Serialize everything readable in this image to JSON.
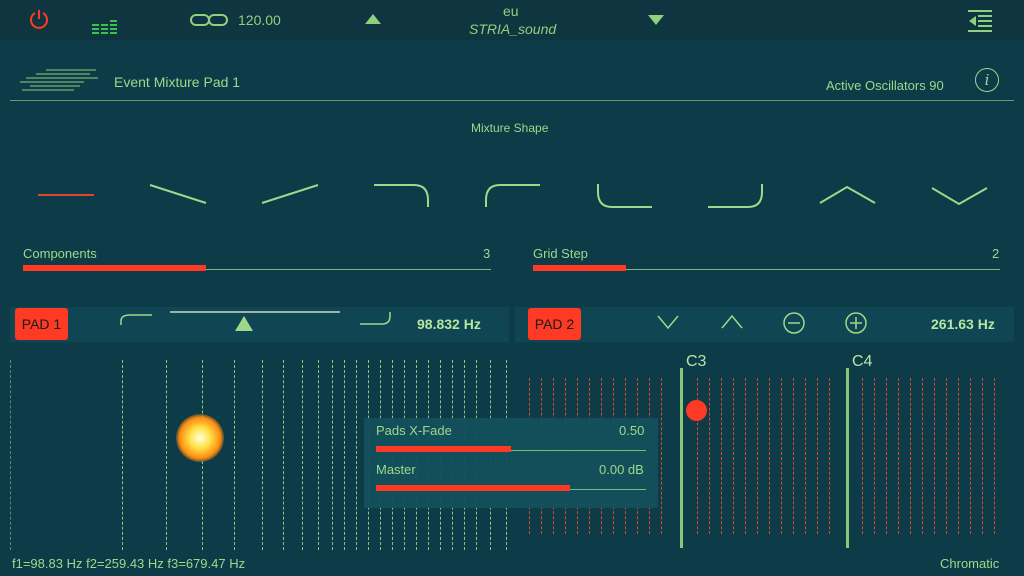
{
  "topbar": {
    "tempo": "120.00",
    "preset_bank": "eu",
    "preset_name": "STRIA_sound"
  },
  "header": {
    "title": "Event Mixture Pad 1",
    "active_oscillators": "Active Oscillators 90",
    "info_glyph": "i"
  },
  "mixture": {
    "label": "Mixture Shape",
    "shapes": [
      "flat",
      "falling",
      "rising",
      "top-right-curve",
      "top-left-curve",
      "bottom-left-curve",
      "bottom-right-curve",
      "peak",
      "valley"
    ]
  },
  "sliders": {
    "components": {
      "label": "Components",
      "value": "3",
      "fraction": 0.39
    },
    "grid_step": {
      "label": "Grid Step",
      "value": "2",
      "fraction": 0.2
    }
  },
  "pad1": {
    "button": "PAD 1",
    "freq": "98.832 Hz"
  },
  "pad2": {
    "button": "PAD 2",
    "freq": "261.63 Hz"
  },
  "xfade": {
    "label": "Pads X-Fade",
    "value": "0.50",
    "fraction": 0.5
  },
  "master": {
    "label": "Master",
    "value": "0.00 dB",
    "fraction": 0.72
  },
  "keys": {
    "c3": "C3",
    "c4": "C4"
  },
  "footer": {
    "freqs": "f1=98.83 Hz f2=259.43 Hz f3=679.47 Hz",
    "scale": "Chromatic"
  },
  "colors": {
    "accent": "#ff3a24",
    "green": "#9fd88a",
    "bg": "#0d3b48"
  }
}
